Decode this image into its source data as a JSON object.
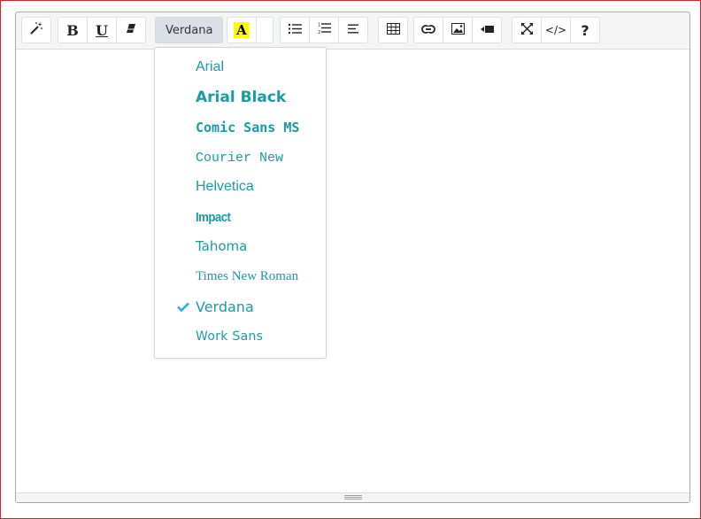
{
  "toolbar": {
    "font_button_label": "Verdana",
    "bold_label": "B",
    "underline_label": "U",
    "highlight_label": "A",
    "help_label": "?",
    "code_label": "</>",
    "icons": [
      "magic-wand-icon",
      "bold-icon",
      "underline-icon",
      "eraser-icon",
      "highlight-icon",
      "bullet-list-icon",
      "numbered-list-icon",
      "align-left-icon",
      "table-icon",
      "link-icon",
      "image-icon",
      "video-icon",
      "fullscreen-icon",
      "code-view-icon",
      "help-icon"
    ]
  },
  "font_menu": {
    "selected": "Verdana",
    "items": [
      {
        "label": "Arial",
        "checked": false
      },
      {
        "label": "Arial Black",
        "checked": false
      },
      {
        "label": "Comic Sans MS",
        "checked": false
      },
      {
        "label": "Courier New",
        "checked": false
      },
      {
        "label": "Helvetica",
        "checked": false
      },
      {
        "label": "Impact",
        "checked": false
      },
      {
        "label": "Tahoma",
        "checked": false
      },
      {
        "label": "Times New Roman",
        "checked": false
      },
      {
        "label": "Verdana",
        "checked": true
      },
      {
        "label": "Work Sans",
        "checked": false
      }
    ]
  },
  "colors": {
    "menu_text": "#1a9aa3",
    "check": "#2ab0d6",
    "highlight": "#ffff00",
    "frame_border": "#d9232a"
  }
}
